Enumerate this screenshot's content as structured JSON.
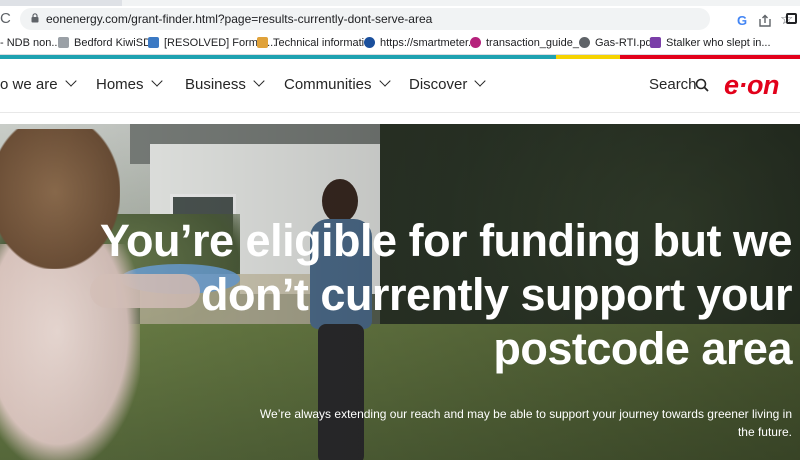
{
  "browser": {
    "url": "eonenergy.com/grant-finder.html?page=results-currently-dont-serve-area",
    "bookmarks": [
      {
        "label": "- NDB non...",
        "icon": "none",
        "color": "#ffffff"
      },
      {
        "label": "Bedford KiwiSDR",
        "icon": "feather-icon",
        "color": "#5f6368"
      },
      {
        "label": "[RESOLVED] Form a...",
        "icon": "vb-icon",
        "color": "#3b79c4"
      },
      {
        "label": "Technical informati...",
        "icon": "megaphone-icon",
        "color": "#e0a23a"
      },
      {
        "label": "https://smartmeter...",
        "icon": "circle-icon",
        "color": "#1a4f9c"
      },
      {
        "label": "transaction_guide_...",
        "icon": "gc-icon",
        "color": "#b5217b"
      },
      {
        "label": "Gas-RTI.pdf",
        "icon": "globe-icon",
        "color": "#5f6368"
      },
      {
        "label": "Stalker who slept in...",
        "icon": "b-icon",
        "color": "#7a3ea8"
      }
    ]
  },
  "nav": {
    "items": [
      {
        "label": "o we are"
      },
      {
        "label": "Homes"
      },
      {
        "label": "Business"
      },
      {
        "label": "Communities"
      },
      {
        "label": "Discover"
      }
    ],
    "search_label": "Search",
    "logo_text": "e·on"
  },
  "hero": {
    "headline": "You’re eligible for funding but we don’t currently support your postcode area",
    "subtext": "We’re always extending our reach and may be able to support your journey towards greener living in the future."
  },
  "colors": {
    "brand_red": "#e2001a",
    "stripe_teal": "#1ea2b1",
    "stripe_yellow": "#f5d300"
  }
}
